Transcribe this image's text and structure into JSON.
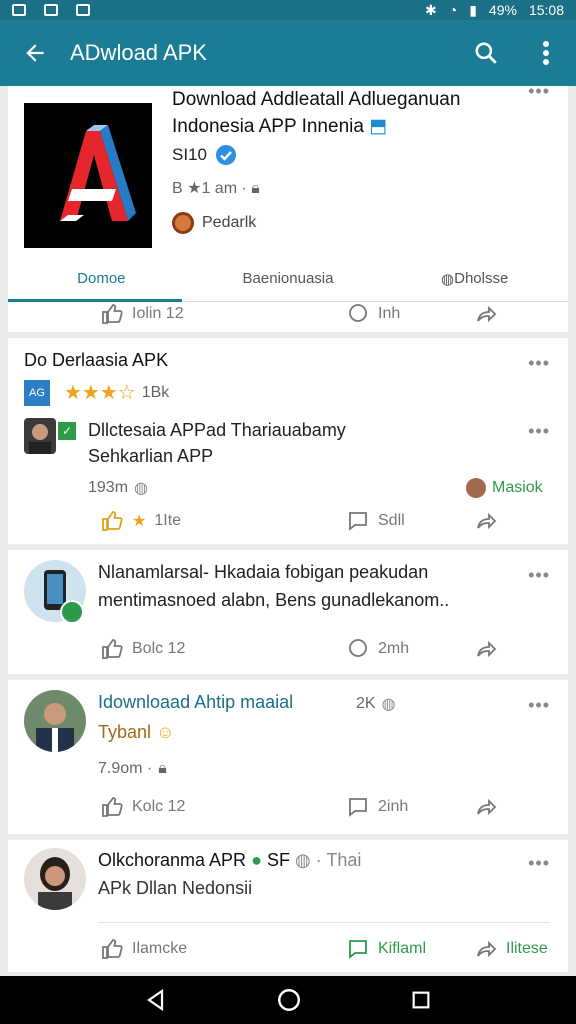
{
  "status_bar": {
    "battery": "49%",
    "time": "15:08"
  },
  "app_bar": {
    "title": "ADwload APK"
  },
  "hero": {
    "title": "Download Addleatall Adlueganuan Indonesia APP Innenia",
    "author": "SI10",
    "meta": "B ★1 am ·",
    "publisher": "Pedarlk",
    "tabs": [
      "Domoe",
      "Baenionuasia",
      "Dholsse"
    ],
    "actions": {
      "like": "Iolin 12",
      "share": "Inh"
    }
  },
  "post1": {
    "title": "Do Derlaasia APK",
    "icon_text": "AG",
    "rating_count": "1Bk",
    "heading": "Dllctesaia APPad Thariauabamy",
    "subheading": "Sehkarlian APP",
    "meta": "193m",
    "tag": "Masiok",
    "actions": {
      "like": "1Ite",
      "comment": "Sdll"
    }
  },
  "post2": {
    "text_line1": "Nlanamlarsal- Hkadaia fobigan peakudan",
    "text_line2": "mentimasnoed alabn, Bens gunadlekanom..",
    "actions": {
      "like": "Bolc 12",
      "comment": "2mh"
    }
  },
  "post3": {
    "title": "Idownloaad Ahtip maaial",
    "count": "2K",
    "subtitle": "Tybanl",
    "meta": "7.9om ·",
    "actions": {
      "like": "Kolc 12",
      "comment": "2inh"
    }
  },
  "post4": {
    "title": "Olkchoranma APR",
    "badge": "SF",
    "suffix": "· Thai",
    "subtitle": "APk Dllan Nedonsii",
    "actions": {
      "like": "Ilamcke",
      "comment": "Kiflaml",
      "share": "Ilitese"
    }
  }
}
